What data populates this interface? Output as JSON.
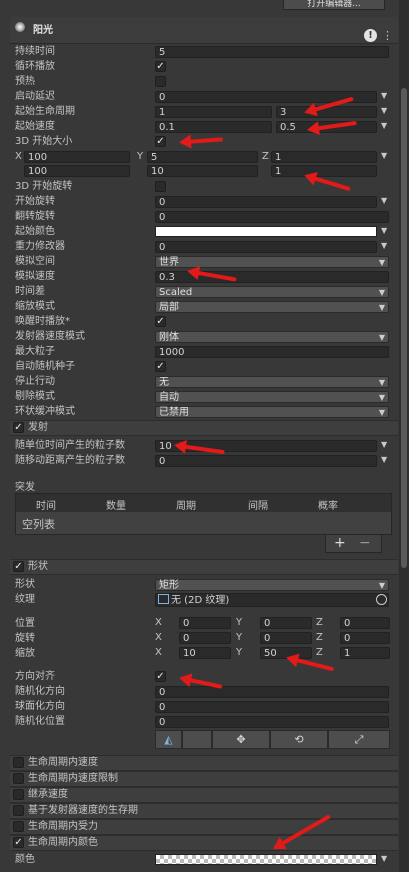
{
  "header": {
    "open_editor": "打开编辑器...",
    "title": "阳光",
    "help_icon": "help-icon",
    "menu_icon": "kebab-icon"
  },
  "main": {
    "duration": {
      "label": "持续时间",
      "value": "5"
    },
    "looping": {
      "label": "循环播放"
    },
    "prewarm": {
      "label": "预热"
    },
    "start_delay": {
      "label": "启动延迟",
      "value": "0"
    },
    "start_lifetime": {
      "label": "起始生命周期",
      "min": "1",
      "max": "3"
    },
    "start_speed": {
      "label": "起始速度",
      "min": "0.1",
      "max": "0.5"
    },
    "size3d": {
      "label": "3D 开始大小"
    },
    "size_axes": {
      "x": "X",
      "y": "Y",
      "z": "Z"
    },
    "size_row1": {
      "x": "100",
      "y": "5",
      "z": "1"
    },
    "size_row2": {
      "x": "100",
      "y": "10",
      "z": "1"
    },
    "rotation3d": {
      "label": "3D 开始旋转"
    },
    "start_rotation": {
      "label": "开始旋转",
      "value": "0"
    },
    "flip_rotation": {
      "label": "翻转旋转",
      "value": "0"
    },
    "start_color": {
      "label": "起始颜色"
    },
    "gravity": {
      "label": "重力修改器",
      "value": "0"
    },
    "sim_space": {
      "label": "模拟空间",
      "value": "世界"
    },
    "sim_speed": {
      "label": "模拟速度",
      "value": "0.3"
    },
    "delta_time": {
      "label": "时间差",
      "value": "Scaled"
    },
    "scaling_mode": {
      "label": "缩放模式",
      "value": "局部"
    },
    "play_on_awake": {
      "label": "唤醒时播放*"
    },
    "emitter_velocity": {
      "label": "发射器速度模式",
      "value": "刚体"
    },
    "max_particles": {
      "label": "最大粒子",
      "value": "1000"
    },
    "auto_seed": {
      "label": "自动随机种子"
    },
    "stop_action": {
      "label": "停止行动",
      "value": "无"
    },
    "culling_mode": {
      "label": "剔除模式",
      "value": "自动"
    },
    "ring_buffer": {
      "label": "环状缓冲模式",
      "value": "已禁用"
    }
  },
  "emission": {
    "title": "发射",
    "rate_time": {
      "label": "随单位时间产生的粒子数",
      "value": "10"
    },
    "rate_distance": {
      "label": "随移动距离产生的粒子数",
      "value": "0"
    },
    "bursts": {
      "label": "突发",
      "columns": [
        "时间",
        "数量",
        "周期",
        "间隔",
        "概率"
      ],
      "empty": "空列表",
      "add": "+",
      "remove": "−"
    }
  },
  "shape": {
    "title": "形状",
    "shape": {
      "label": "形状",
      "value": "矩形"
    },
    "texture": {
      "label": "纹理",
      "value": "无 (2D 纹理)"
    },
    "position": {
      "label": "位置",
      "x": "0",
      "y": "0",
      "z": "0"
    },
    "rotation": {
      "label": "旋转",
      "x": "0",
      "y": "0",
      "z": "0"
    },
    "scale": {
      "label": "缩放",
      "x": "10",
      "y": "50",
      "z": "1"
    },
    "align_direction": {
      "label": "方向对齐"
    },
    "randomize_direction": {
      "label": "随机化方向",
      "value": "0"
    },
    "spherize_direction": {
      "label": "球面化方向",
      "value": "0"
    },
    "randomize_position": {
      "label": "随机化位置",
      "value": "0"
    }
  },
  "modules": [
    {
      "label": "生命周期内速度",
      "checked": false
    },
    {
      "label": "生命周期内速度限制",
      "checked": false
    },
    {
      "label": "继承速度",
      "checked": false
    },
    {
      "label": "基于发射器速度的生存期",
      "checked": false
    },
    {
      "label": "生命周期内受力",
      "checked": false
    },
    {
      "label": "生命周期内颜色",
      "checked": true
    }
  ],
  "color_over_lifetime": {
    "label": "颜色"
  },
  "colors": {
    "annotation": "#e21a1a",
    "panel": "#383838",
    "field": "#2a2a2a"
  }
}
